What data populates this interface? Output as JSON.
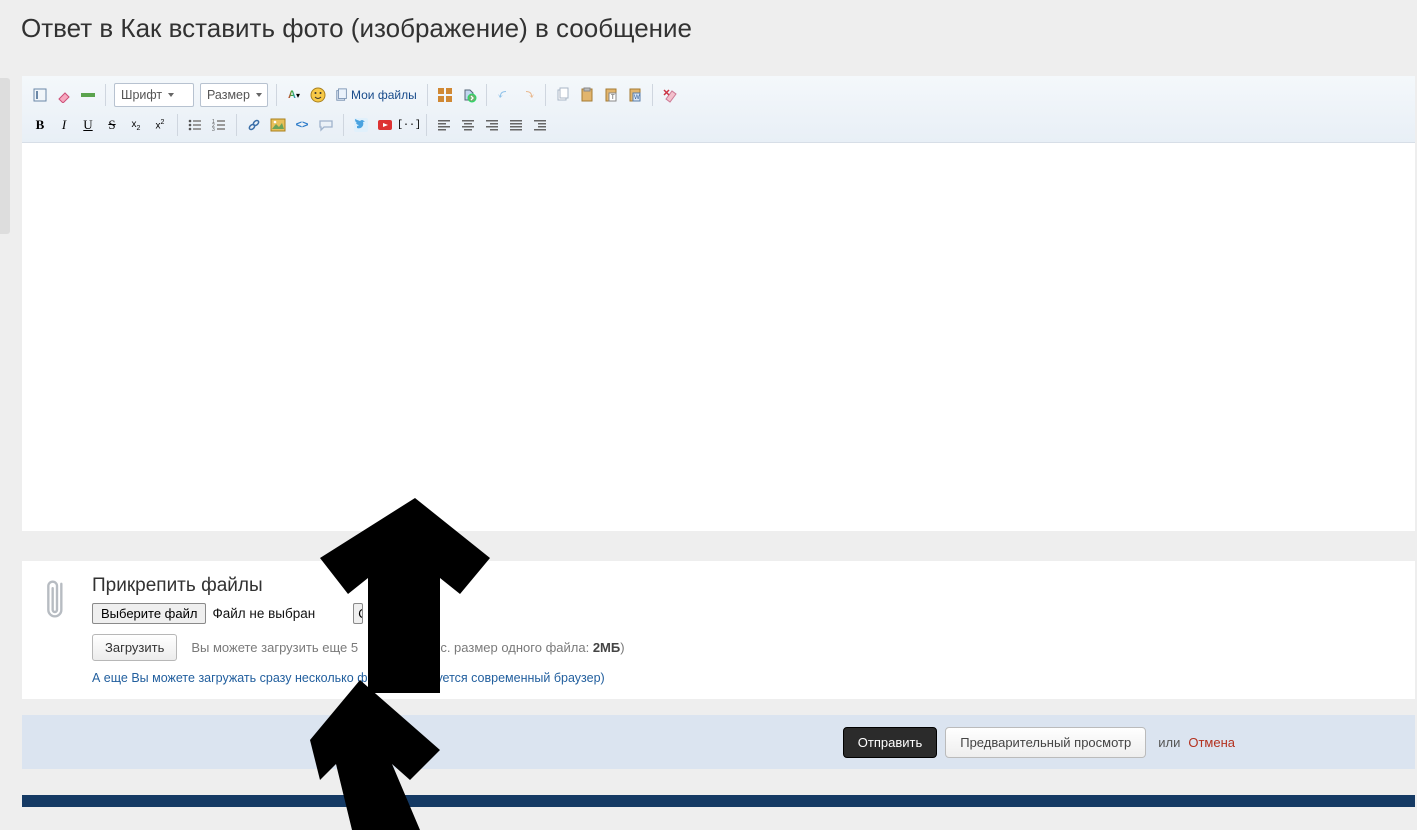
{
  "page": {
    "title": "Ответ в Как вставить фото (изображение) в сообщение"
  },
  "toolbar": {
    "font_label": "Шрифт",
    "size_label": "Размер",
    "myfiles_label": "Мои файлы"
  },
  "attach": {
    "title": "Прикрепить файлы",
    "choose_file_btn": "Выберите файл",
    "no_file_text": "Файл не выбран",
    "clear_btn": "О",
    "upload_btn": "Загрузить",
    "hint_prefix": "Вы можете загрузить еще ",
    "hint_count": "5",
    "hint_mid": "ов (Макс. размер одного файла: ",
    "max_size": "2МБ",
    "hint_suffix": ")",
    "multi_link_text": "А еще Вы можете загружать сразу несколько файлов (требуется современный браузер)"
  },
  "submit": {
    "send_btn": "Отправить",
    "preview_btn": "Предварительный просмотр",
    "or_text": "или",
    "cancel_link": "Отмена"
  }
}
